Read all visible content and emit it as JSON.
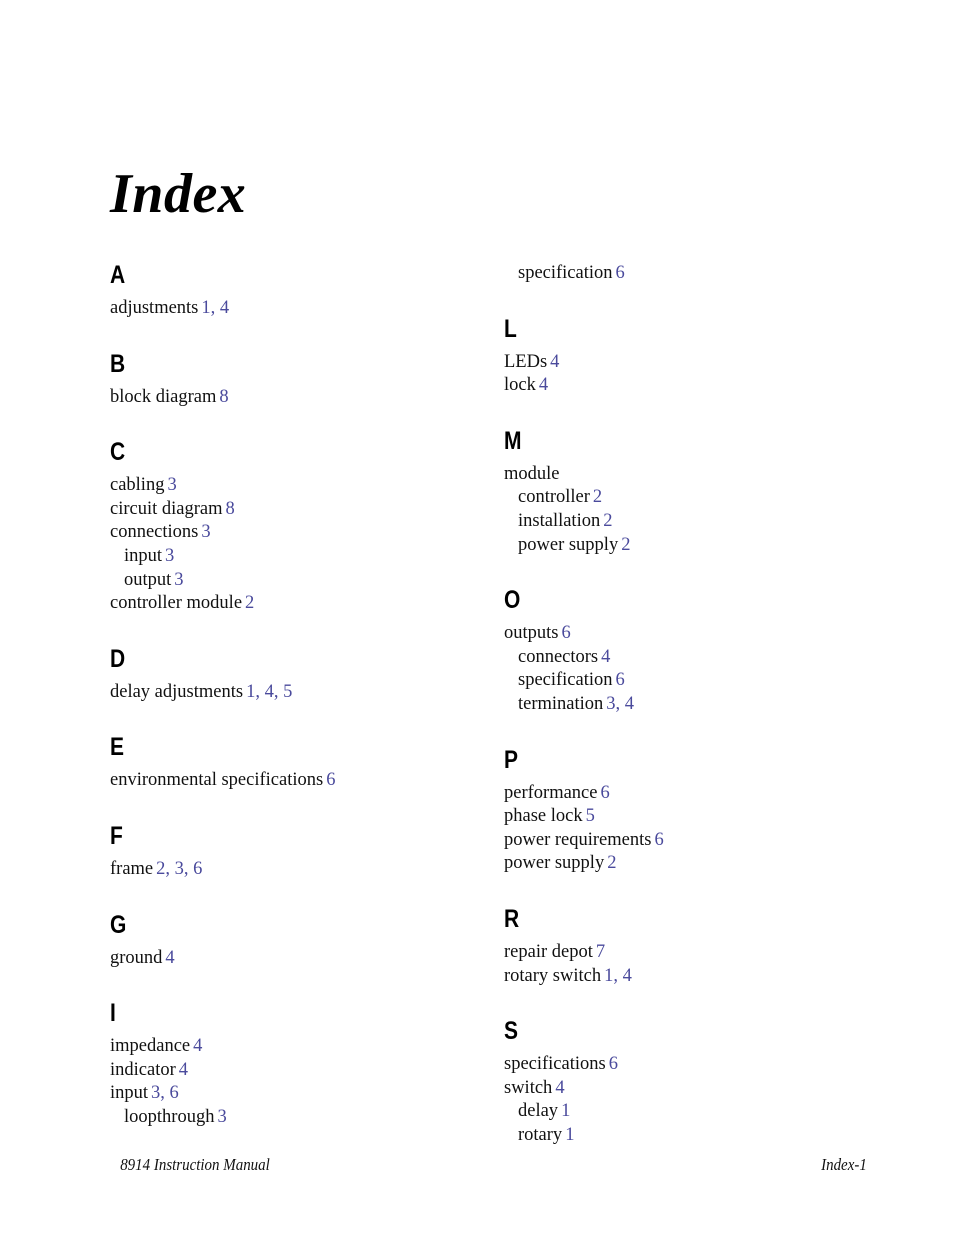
{
  "document": {
    "title": "Index"
  },
  "footer": {
    "manual": "8914 Instruction Manual",
    "page_label": "Index-1"
  },
  "columns": {
    "left": [
      {
        "heading": "A",
        "entries": [
          {
            "term": "adjustments",
            "pages": "1, 4",
            "level": 0
          }
        ]
      },
      {
        "heading": "B",
        "entries": [
          {
            "term": "block diagram",
            "pages": "8",
            "level": 0
          }
        ]
      },
      {
        "heading": "C",
        "entries": [
          {
            "term": "cabling",
            "pages": "3",
            "level": 0
          },
          {
            "term": "circuit diagram",
            "pages": "8",
            "level": 0
          },
          {
            "term": "connections",
            "pages": "3",
            "level": 0
          },
          {
            "term": "input",
            "pages": "3",
            "level": 1
          },
          {
            "term": "output",
            "pages": "3",
            "level": 1
          },
          {
            "term": "controller module",
            "pages": "2",
            "level": 0
          }
        ]
      },
      {
        "heading": "D",
        "entries": [
          {
            "term": "delay adjustments",
            "pages": "1, 4, 5",
            "level": 0
          }
        ]
      },
      {
        "heading": "E",
        "entries": [
          {
            "term": "environmental specifications",
            "pages": "6",
            "level": 0
          }
        ]
      },
      {
        "heading": "F",
        "entries": [
          {
            "term": "frame",
            "pages": "2, 3, 6",
            "level": 0
          }
        ]
      },
      {
        "heading": "G",
        "entries": [
          {
            "term": "ground",
            "pages": "4",
            "level": 0
          }
        ]
      },
      {
        "heading": "I",
        "entries": [
          {
            "term": "impedance",
            "pages": "4",
            "level": 0
          },
          {
            "term": "indicator",
            "pages": "4",
            "level": 0
          },
          {
            "term": "input",
            "pages": "3, 6",
            "level": 0
          },
          {
            "term": "loopthrough",
            "pages": "3",
            "level": 1
          }
        ]
      }
    ],
    "right": [
      {
        "heading": "",
        "entries": [
          {
            "term": "specification",
            "pages": "6",
            "level": 1
          }
        ]
      },
      {
        "heading": "L",
        "entries": [
          {
            "term": "LEDs",
            "pages": "4",
            "level": 0
          },
          {
            "term": "lock",
            "pages": "4",
            "level": 0
          }
        ]
      },
      {
        "heading": "M",
        "entries": [
          {
            "term": "module",
            "pages": "",
            "level": 0
          },
          {
            "term": "controller",
            "pages": "2",
            "level": 1
          },
          {
            "term": "installation",
            "pages": "2",
            "level": 1
          },
          {
            "term": "power supply",
            "pages": "2",
            "level": 1
          }
        ]
      },
      {
        "heading": "O",
        "entries": [
          {
            "term": "outputs",
            "pages": "6",
            "level": 0
          },
          {
            "term": "connectors",
            "pages": "4",
            "level": 1
          },
          {
            "term": "specification",
            "pages": "6",
            "level": 1
          },
          {
            "term": "termination",
            "pages": "3, 4",
            "level": 1
          }
        ]
      },
      {
        "heading": "P",
        "entries": [
          {
            "term": "performance",
            "pages": "6",
            "level": 0
          },
          {
            "term": "phase lock",
            "pages": "5",
            "level": 0
          },
          {
            "term": "power requirements",
            "pages": "6",
            "level": 0
          },
          {
            "term": "power supply",
            "pages": "2",
            "level": 0
          }
        ]
      },
      {
        "heading": "R",
        "entries": [
          {
            "term": "repair depot",
            "pages": "7",
            "level": 0
          },
          {
            "term": "rotary switch",
            "pages": "1, 4",
            "level": 0
          }
        ]
      },
      {
        "heading": "S",
        "entries": [
          {
            "term": "specifications",
            "pages": "6",
            "level": 0
          },
          {
            "term": "switch",
            "pages": "4",
            "level": 0
          },
          {
            "term": "delay",
            "pages": "1",
            "level": 1
          },
          {
            "term": "rotary",
            "pages": "1",
            "level": 1
          }
        ]
      }
    ]
  },
  "colors": {
    "page_number": "#4a4a9c",
    "text": "#111111",
    "background": "#ffffff"
  }
}
